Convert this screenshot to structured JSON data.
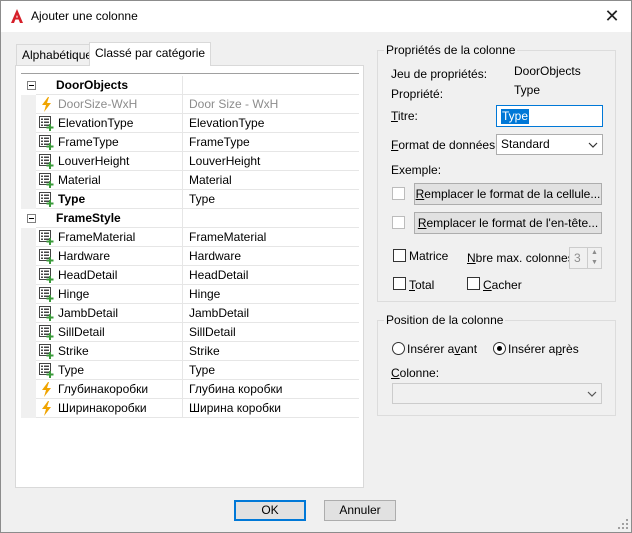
{
  "window": {
    "title": "Ajouter une colonne",
    "close_glyph": "✕",
    "app_icon": "autocad-a-icon"
  },
  "tabs": [
    {
      "label": "Alphabétique",
      "active": false
    },
    {
      "label": "Classé par catégorie",
      "active": true
    }
  ],
  "grid": {
    "categories": [
      {
        "name": "DoorObjects",
        "rows": [
          {
            "name": "DoorSize-WxH",
            "value": "Door Size - WxH",
            "icon": "formula-lightning-icon",
            "disabled": true
          },
          {
            "name": "ElevationType",
            "value": "ElevationType",
            "icon": "property-field-icon"
          },
          {
            "name": "FrameType",
            "value": "FrameType",
            "icon": "property-field-icon"
          },
          {
            "name": "LouverHeight",
            "value": "LouverHeight",
            "icon": "property-field-icon"
          },
          {
            "name": "Material",
            "value": "Material",
            "icon": "property-field-icon"
          },
          {
            "name": "Type",
            "value": "Type",
            "icon": "property-field-icon",
            "bold": true
          }
        ]
      },
      {
        "name": "FrameStyle",
        "rows": [
          {
            "name": "FrameMaterial",
            "value": "FrameMaterial",
            "icon": "property-field-icon"
          },
          {
            "name": "Hardware",
            "value": "Hardware",
            "icon": "property-field-icon"
          },
          {
            "name": "HeadDetail",
            "value": "HeadDetail",
            "icon": "property-field-icon"
          },
          {
            "name": "Hinge",
            "value": "Hinge",
            "icon": "property-field-icon"
          },
          {
            "name": "JambDetail",
            "value": "JambDetail",
            "icon": "property-field-icon"
          },
          {
            "name": "SillDetail",
            "value": "SillDetail",
            "icon": "property-field-icon"
          },
          {
            "name": "Strike",
            "value": "Strike",
            "icon": "property-field-icon"
          },
          {
            "name": "Type",
            "value": "Type",
            "icon": "property-field-icon"
          },
          {
            "name": "Глубинакоробки",
            "value": "Глубина коробки",
            "icon": "formula-lightning-icon"
          },
          {
            "name": "Ширинакоробки",
            "value": "Ширина коробки",
            "icon": "formula-lightning-icon"
          }
        ]
      }
    ]
  },
  "props": {
    "group_label": "Propriétés de la colonne",
    "propset_label": "Jeu de propriétés:",
    "propset_value": "DoorObjects",
    "property_label": "Propriété:",
    "property_value": "Type",
    "title_label": "Titre:",
    "title_value": "Type",
    "format_label": "Format de données:",
    "format_value": "Standard",
    "example_label": "Exemple:",
    "override_cell_btn": "Remplacer le format de la cellule...",
    "override_header_btn": "Remplacer le format de l'en-tête...",
    "matrix_label": "Matrice",
    "max_cols_label": "Nbre max. colonnes:",
    "max_cols_value": "3",
    "total_label": "Total",
    "hide_label": "Cacher"
  },
  "position": {
    "group_label": "Position de  la colonne",
    "insert_before": "Insérer avant",
    "insert_after": "Insérer après",
    "selected": "after",
    "column_label": "Colonne:",
    "column_value": ""
  },
  "buttons": {
    "ok": "OK",
    "cancel": "Annuler"
  },
  "colors": {
    "accent": "#0078d7",
    "formula_icon": "#f0a400",
    "field_icon_green": "#3a9a3a",
    "app_red": "#d6202a"
  }
}
